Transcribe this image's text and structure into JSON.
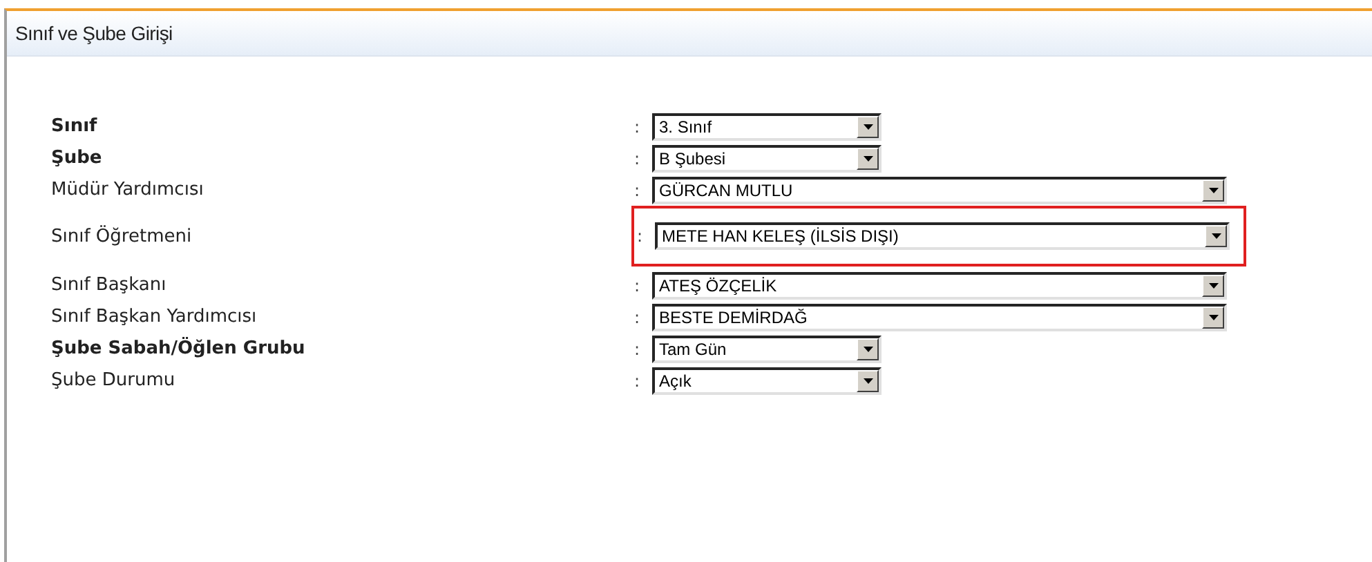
{
  "panel": {
    "title": "Sınıf ve Şube Girişi"
  },
  "rows": [
    {
      "label": "Sınıf",
      "bold": true,
      "separator": ":",
      "value": "3. Sınıf",
      "kind": "short",
      "highlighted": false
    },
    {
      "label": "Şube",
      "bold": true,
      "separator": ":",
      "value": "B Şubesi",
      "kind": "short",
      "highlighted": false
    },
    {
      "label": "Müdür Yardımcısı",
      "bold": false,
      "separator": ":",
      "value": "GÜRCAN MUTLU",
      "kind": "long",
      "highlighted": false
    },
    {
      "label": "Sınıf Öğretmeni",
      "bold": false,
      "separator": ":",
      "value": "METE HAN KELEŞ (İLSİS DIŞI)",
      "kind": "long",
      "highlighted": true
    },
    {
      "label": "Sınıf Başkanı",
      "bold": false,
      "separator": ":",
      "value": "ATEŞ ÖZÇELİK",
      "kind": "long",
      "highlighted": false
    },
    {
      "label": "Sınıf Başkan Yardımcısı",
      "bold": false,
      "separator": ":",
      "value": "BESTE DEMİRDAĞ",
      "kind": "long",
      "highlighted": false
    },
    {
      "label": "Şube Sabah/Öğlen Grubu",
      "bold": true,
      "separator": ":",
      "value": "Tam Gün",
      "kind": "short",
      "highlighted": false
    },
    {
      "label": "Şube Durumu",
      "bold": false,
      "separator": ":",
      "value": "Açık",
      "kind": "short",
      "highlighted": false
    }
  ]
}
